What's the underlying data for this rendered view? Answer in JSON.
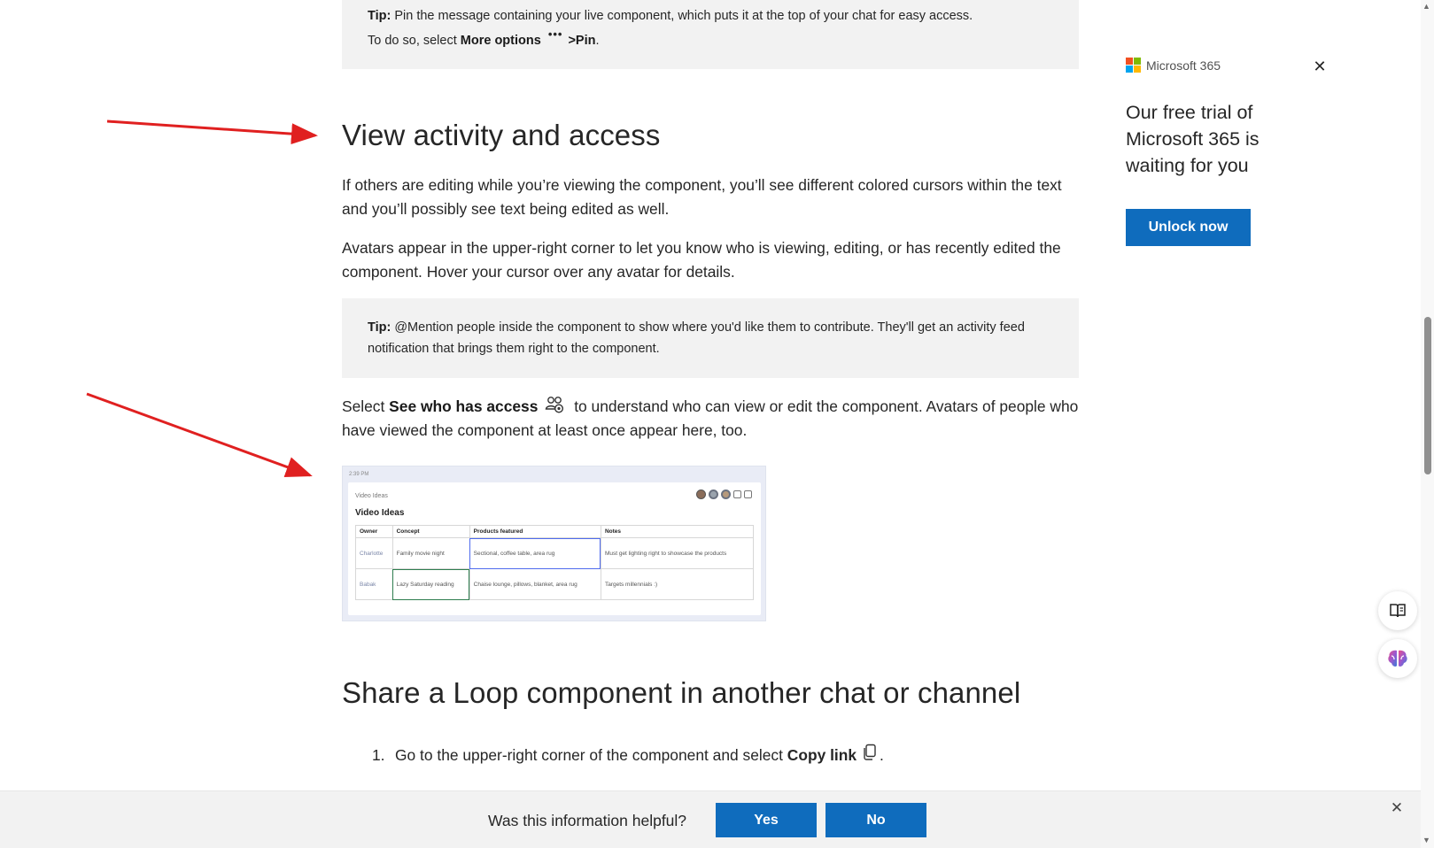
{
  "tip_top": {
    "label": "Tip:",
    "line1": " Pin the message containing your live component, which puts it at the top of your chat for easy access.",
    "line2_prefix": "To do so, select ",
    "more_options": "More options",
    "more_icon": "•••",
    "pin": ">Pin",
    "period": "."
  },
  "section_activity": {
    "heading": "View activity and access",
    "p1": "If others are editing while you’re viewing the component, you’ll see different colored cursors within the text and you’ll possibly see text being edited as well.",
    "p2": "Avatars appear in the upper-right corner to let you know who is viewing, editing, or has recently edited the component. Hover your cursor over any avatar for details.",
    "tip_label": "Tip:",
    "tip_text": " @Mention people inside the component to show where you'd like them to contribute. They'll get an activity feed notification that brings them right to the component.",
    "p3_prefix": "Select ",
    "p3_bold": "See who has access",
    "p3_suffix": " to understand who can view or edit the component. Avatars of people who have viewed the component at least once appear here, too."
  },
  "screenshot": {
    "time": "2:39 PM",
    "small_title": "Video Ideas",
    "title": "Video Ideas",
    "columns": [
      "Owner",
      "Concept",
      "Products featured",
      "Notes"
    ],
    "rows": [
      [
        "Charlotte",
        "Family movie night",
        "Sectional, coffee table, area rug",
        "Must get lighting right to showcase the products"
      ],
      [
        "Babak",
        "Lazy Saturday reading",
        "Chaise lounge, pillows, blanket, area rug",
        "Targets millennials :)"
      ]
    ]
  },
  "section_share": {
    "heading": "Share a Loop component in another chat or channel",
    "step1_num": "1.",
    "step1_prefix": "Go to the upper-right corner of the component and select ",
    "step1_bold": "Copy link",
    "step1_suffix": "."
  },
  "ad": {
    "brand": "Microsoft 365",
    "text": "Our free trial of Microsoft 365 is waiting for you",
    "button": "Unlock now",
    "close": "✕",
    "logo_colors": [
      "#f25022",
      "#7fba00",
      "#00a4ef",
      "#ffb900"
    ]
  },
  "feedback": {
    "question": "Was this information helpful?",
    "yes": "Yes",
    "no": "No",
    "close": "✕"
  },
  "colors": {
    "accent": "#0f6cbd",
    "arrow": "#e02020",
    "tip_bg": "#f2f2f2"
  }
}
